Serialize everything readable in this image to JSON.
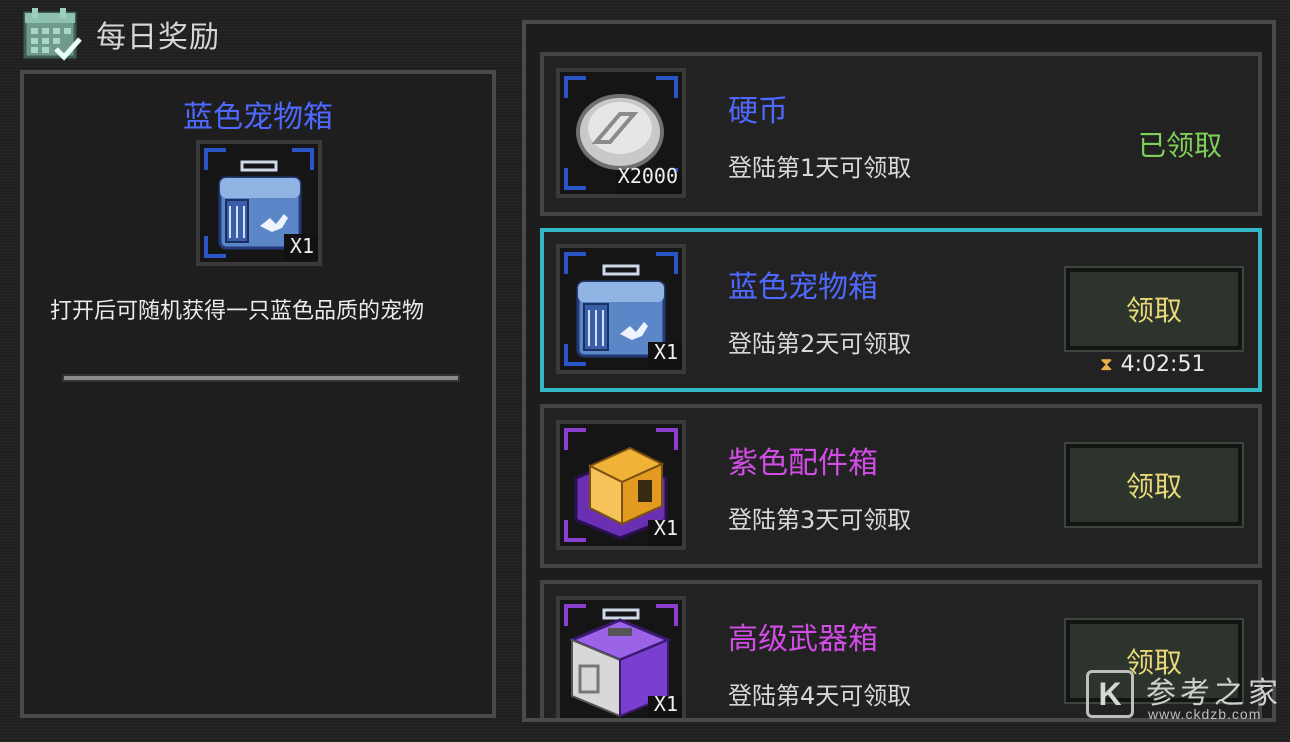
{
  "header": {
    "title": "每日奖励",
    "icon": "calendar-check-icon"
  },
  "detail": {
    "name": "蓝色宠物箱",
    "name_color": "#4f68ff",
    "qty": "X1",
    "description": "打开后可随机获得一只蓝色品质的宠物"
  },
  "rewards": [
    {
      "name": "硬币",
      "name_color": "#4f68ff",
      "subtitle": "登陆第1天可领取",
      "qty": "X2000",
      "status": "已领取",
      "icon": "coin-icon"
    },
    {
      "name": "蓝色宠物箱",
      "name_color": "#4f68ff",
      "subtitle": "登陆第2天可领取",
      "qty": "X1",
      "button": "领取",
      "timer": "4:02:51",
      "selected": true,
      "icon": "blue-pet-box-icon"
    },
    {
      "name": "紫色配件箱",
      "name_color": "#d24ce6",
      "subtitle": "登陆第3天可领取",
      "qty": "X1",
      "button": "领取",
      "icon": "purple-parts-box-icon"
    },
    {
      "name": "高级武器箱",
      "name_color": "#d24ce6",
      "subtitle": "登陆第4天可领取",
      "qty": "X1",
      "button": "领取",
      "icon": "weapon-box-icon"
    }
  ],
  "watermark": {
    "logo": "K",
    "text": "参考之家",
    "url": "www.ckdzb.com"
  }
}
